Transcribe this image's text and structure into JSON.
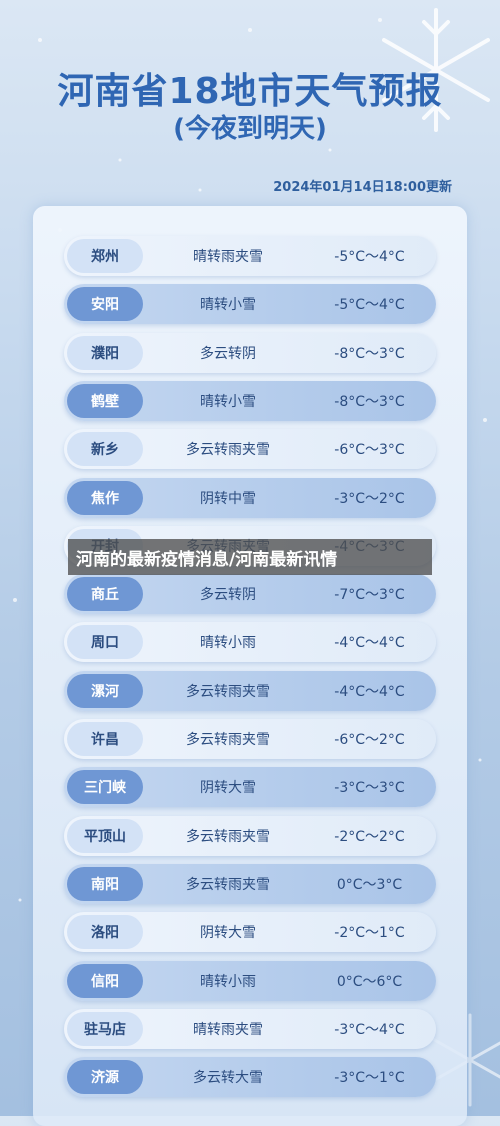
{
  "header": {
    "title": "河南省18地市天气预报",
    "subtitle": "(今夜到明天)",
    "update_time": "2024年01月14日18:00更新"
  },
  "banner": {
    "text": "河南的最新疫情消息/河南最新讯情"
  },
  "rows": [
    {
      "city": "郑州",
      "weather": "晴转雨夹雪",
      "temp": "-5°C～4°C"
    },
    {
      "city": "安阳",
      "weather": "晴转小雪",
      "temp": "-5°C～4°C"
    },
    {
      "city": "濮阳",
      "weather": "多云转阴",
      "temp": "-8°C～3°C"
    },
    {
      "city": "鹤壁",
      "weather": "晴转小雪",
      "temp": "-8°C～3°C"
    },
    {
      "city": "新乡",
      "weather": "多云转雨夹雪",
      "temp": "-6°C～3°C"
    },
    {
      "city": "焦作",
      "weather": "阴转中雪",
      "temp": "-3°C～2°C"
    },
    {
      "city": "开封",
      "weather": "多云转雨夹雪",
      "temp": "-4°C～3°C"
    },
    {
      "city": "商丘",
      "weather": "多云转阴",
      "temp": "-7°C～3°C"
    },
    {
      "city": "周口",
      "weather": "晴转小雨",
      "temp": "-4°C～4°C"
    },
    {
      "city": "漯河",
      "weather": "多云转雨夹雪",
      "temp": "-4°C～4°C"
    },
    {
      "city": "许昌",
      "weather": "多云转雨夹雪",
      "temp": "-6°C～2°C"
    },
    {
      "city": "三门峡",
      "weather": "阴转大雪",
      "temp": "-3°C～3°C"
    },
    {
      "city": "平顶山",
      "weather": "多云转雨夹雪",
      "temp": "-2°C～2°C"
    },
    {
      "city": "南阳",
      "weather": "多云转雨夹雪",
      "temp": "0°C～3°C"
    },
    {
      "city": "洛阳",
      "weather": "阴转大雪",
      "temp": "-2°C～1°C"
    },
    {
      "city": "信阳",
      "weather": "晴转小雨",
      "temp": "0°C～6°C"
    },
    {
      "city": "驻马店",
      "weather": "晴转雨夹雪",
      "temp": "-3°C～4°C"
    },
    {
      "city": "济源",
      "weather": "多云转大雪",
      "temp": "-3°C～1°C"
    }
  ]
}
